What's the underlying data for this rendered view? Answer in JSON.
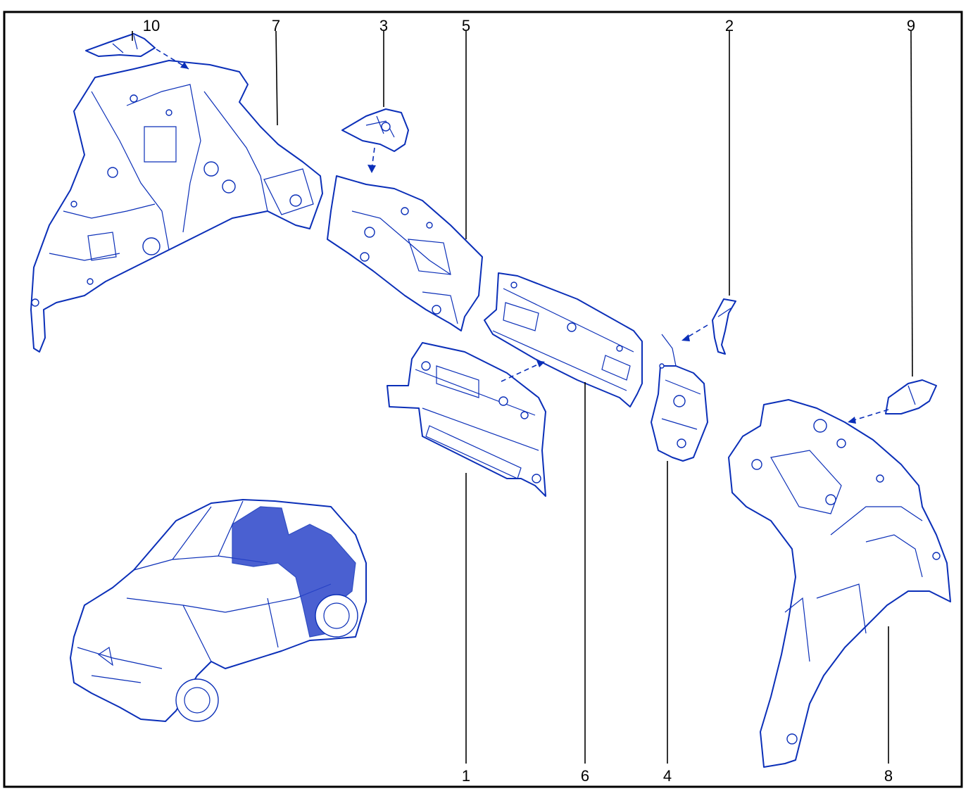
{
  "callouts": [
    {
      "id": "10",
      "label": "10"
    },
    {
      "id": "7",
      "label": "7"
    },
    {
      "id": "3",
      "label": "3"
    },
    {
      "id": "5",
      "label": "5"
    },
    {
      "id": "2",
      "label": "2"
    },
    {
      "id": "9",
      "label": "9"
    },
    {
      "id": "1",
      "label": "1"
    },
    {
      "id": "6",
      "label": "6"
    },
    {
      "id": "4",
      "label": "4"
    },
    {
      "id": "8",
      "label": "8"
    }
  ],
  "colors": {
    "line_art": "#0b2fb8",
    "frame": "#000000",
    "background": "#ffffff"
  }
}
